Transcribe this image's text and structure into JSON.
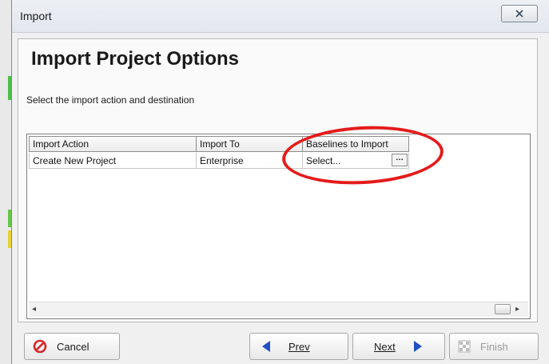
{
  "window": {
    "title": "Import",
    "close_glyph": "✕"
  },
  "page": {
    "heading": "Import Project Options",
    "instruction": "Select the import action and destination"
  },
  "table": {
    "columns": [
      "Import Action",
      "Import To",
      "Baselines to Import"
    ],
    "rows": [
      {
        "import_action": "Create New Project",
        "import_to": "Enterprise",
        "baselines": "Select...",
        "picker_label": "…"
      }
    ]
  },
  "buttons": {
    "cancel": "Cancel",
    "prev": "Prev",
    "next": "Next",
    "finish": "Finish"
  },
  "colors": {
    "highlight": "#e51b1b",
    "cancel_icon": "#d9272e",
    "nav_arrow": "#1f4fc4"
  },
  "icons": [
    "close-icon",
    "cancel-icon",
    "prev-arrow-icon",
    "next-arrow-icon",
    "finish-icon"
  ]
}
